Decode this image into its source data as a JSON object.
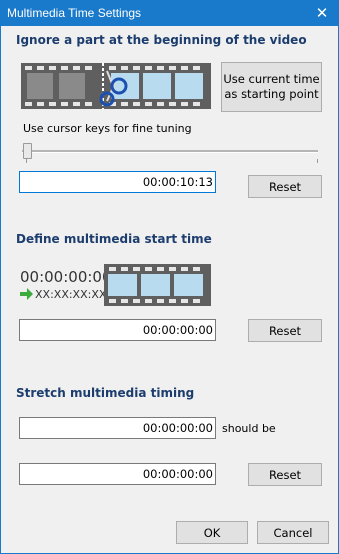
{
  "window": {
    "title": "Multimedia Time Settings",
    "close_glyph": "✕"
  },
  "ignore": {
    "heading": "Ignore a part at the beginning of the video",
    "use_current_button": "Use current time as starting point",
    "cursor_hint": "Use cursor keys for fine tuning",
    "time_value": "00:00:10:13",
    "reset_label": "Reset"
  },
  "define": {
    "heading": "Define multimedia start time",
    "big_time": "00:00:00:00",
    "placeholder_time": "XX:XX:XX:XX",
    "time_value": "00:00:00:00",
    "reset_label": "Reset"
  },
  "stretch": {
    "heading": "Stretch multimedia timing",
    "from_value": "00:00:00:00",
    "should_be_label": "should be",
    "to_value": "00:00:00:00",
    "reset_label": "Reset"
  },
  "footer": {
    "ok_label": "OK",
    "cancel_label": "Cancel"
  },
  "colors": {
    "titlebar": "#1979ca",
    "heading": "#1c3d6e",
    "film": "#595959",
    "frame": "#b9dbef",
    "arrow": "#3daa3d"
  },
  "icons": [
    "close-icon",
    "scissors-icon",
    "filmstrip-icon",
    "green-arrow-icon"
  ]
}
